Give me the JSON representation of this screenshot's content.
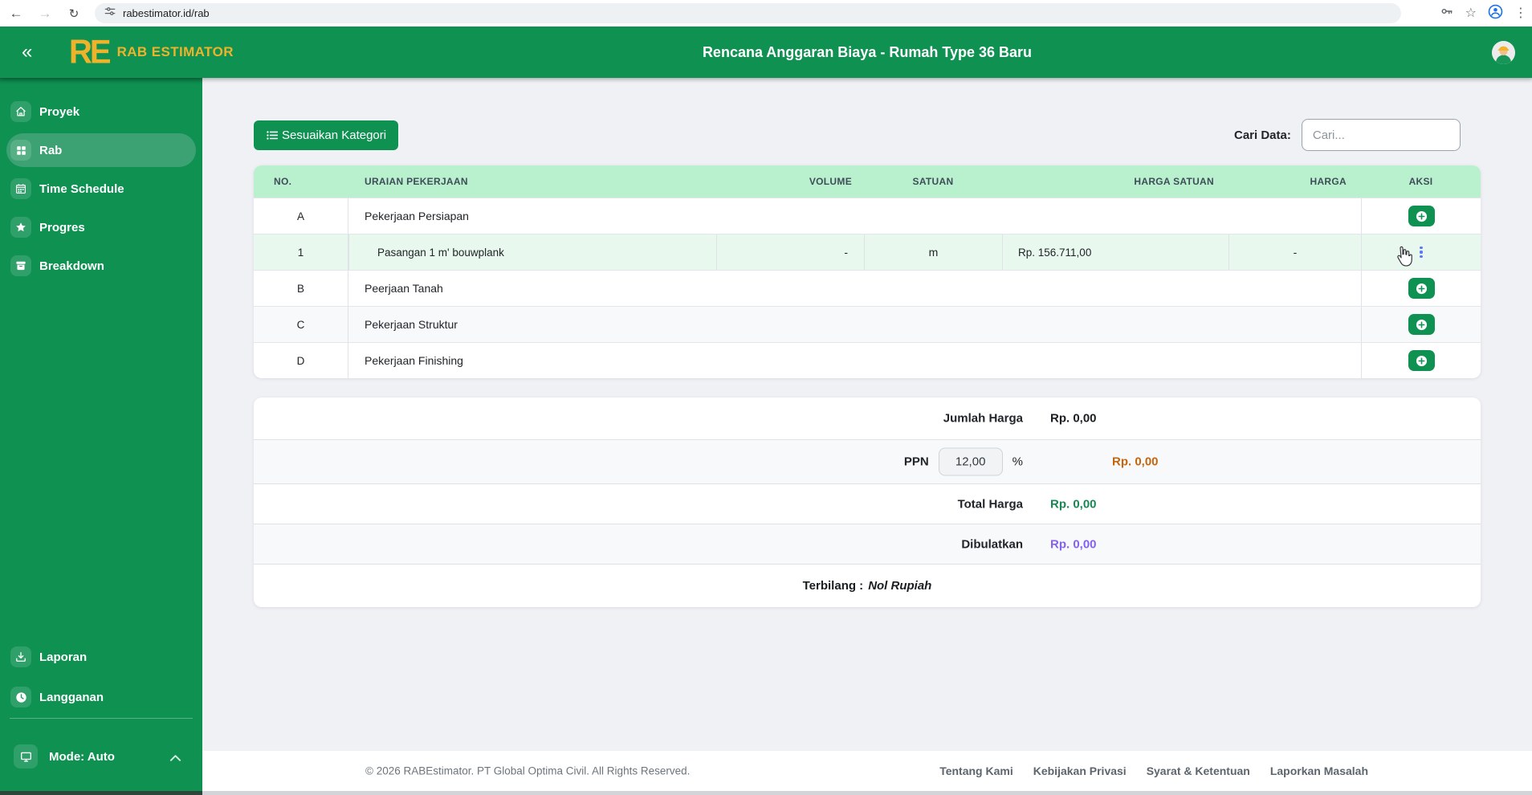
{
  "browser": {
    "url": "rabestimator.id/rab"
  },
  "icons": {
    "back": "←",
    "forward": "→",
    "reload": "↻",
    "bookmark": "☆",
    "menu": "⋮",
    "collapse": "«"
  },
  "header": {
    "brand_mark": "RE",
    "brand": "RAB ESTIMATOR",
    "title": "Rencana Anggaran Biaya - Rumah Type 36 Baru"
  },
  "sidebar": {
    "items": [
      {
        "label": "Proyek",
        "icon": "home-icon",
        "active": false
      },
      {
        "label": "Rab",
        "icon": "grid-icon",
        "active": true
      },
      {
        "label": "Time Schedule",
        "icon": "calendar-icon",
        "active": false
      },
      {
        "label": "Progres",
        "icon": "star-icon",
        "active": false
      },
      {
        "label": "Breakdown",
        "icon": "box-icon",
        "active": false
      }
    ],
    "bottom_items": [
      {
        "label": "Laporan",
        "icon": "download-icon"
      },
      {
        "label": "Langganan",
        "icon": "clock-icon"
      }
    ],
    "mode_label": "Mode: Auto"
  },
  "toolbar": {
    "category_button": "Sesuaikan Kategori",
    "search_label": "Cari Data:",
    "search_placeholder": "Cari..."
  },
  "table": {
    "columns": [
      "NO.",
      "URAIAN PEKERJAAN",
      "VOLUME",
      "SATUAN",
      "HARGA SATUAN",
      "HARGA",
      "AKSI"
    ],
    "rows": [
      {
        "no": "A",
        "name": "Pekerjaan Persiapan",
        "type": "category"
      },
      {
        "no": "1",
        "name": "Pasangan 1 m' bouwplank",
        "volume": "-",
        "satuan": "m",
        "harga_satuan": "Rp. 156.711,00",
        "harga": "-",
        "type": "item"
      },
      {
        "no": "B",
        "name": "Peerjaan Tanah",
        "type": "category"
      },
      {
        "no": "C",
        "name": "Pekerjaan Struktur",
        "type": "category"
      },
      {
        "no": "D",
        "name": "Pekerjaan Finishing",
        "type": "category"
      }
    ]
  },
  "summary": {
    "jumlah_label": "Jumlah Harga",
    "jumlah_value": "Rp. 0,00",
    "ppn_label": "PPN",
    "ppn_input": "12,00",
    "ppn_unit": "%",
    "ppn_value": "Rp. 0,00",
    "total_label": "Total Harga",
    "total_value": "Rp. 0,00",
    "rounded_label": "Dibulatkan",
    "rounded_value": "Rp. 0,00",
    "terbilang_label": "Terbilang :",
    "terbilang_value": "Nol Rupiah"
  },
  "footer": {
    "copyright": "© 2026 RABEstimator. PT Global Optima Civil. All Rights Reserved.",
    "links": [
      "Tentang Kami",
      "Kebijakan Privasi",
      "Syarat & Ketentuan",
      "Laporkan Masalah"
    ]
  },
  "colors": {
    "primary_green": "#0f9152",
    "brand_gold": "#efb32b",
    "table_header_bg": "#b9f1ce",
    "row_highlight_bg": "#e9f8ef",
    "ppn_amount": "#c4650e",
    "total_amount": "#198754",
    "rounded_amount": "#8561f0",
    "kebab_blue": "#5b79f2"
  }
}
